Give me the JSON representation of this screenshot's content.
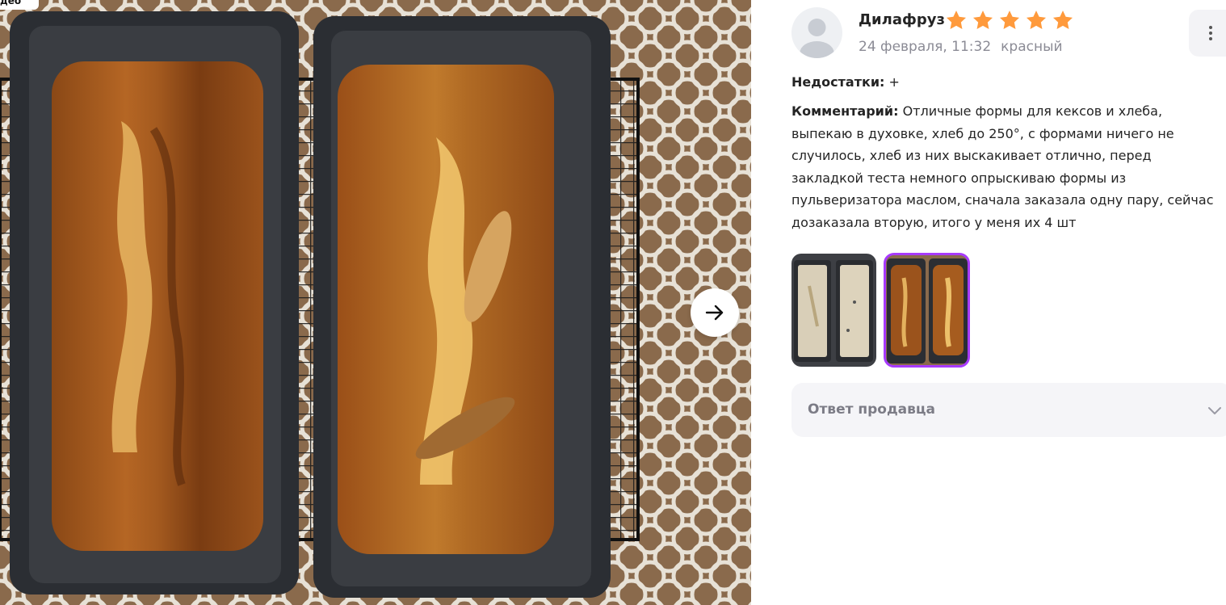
{
  "viewer": {
    "corner_tab_label": "део",
    "photo_alt": "Two banana bread loaves in dark rectangular baking pans on a wire rack over a lace tablecloth"
  },
  "review": {
    "author": "Дилафруз",
    "rating": 5,
    "rating_max": 5,
    "date": "24 февраля, 11:32",
    "color": "красный",
    "cons_label": "Недостатки:",
    "cons_value": "+",
    "comment_label": "Комментарий:",
    "comment_text": "Отличные формы для кексов и хлеба, выпекаю в духовке, хлеб до 250°, с формами ничего не случилось, хлеб из них выскакивает отлично, перед закладкой теста немного опрыскиваю формы из пульверизатора маслом, сначала заказала одну пару, сейчас дозаказала вторую, итого у меня их 4 шт",
    "seller_reply_label": "Ответ продавца"
  },
  "thumbnails": [
    {
      "name": "raw-dough-photo",
      "selected": false
    },
    {
      "name": "baked-bread-photo",
      "selected": true
    }
  ],
  "colors": {
    "star": "#ff9a3c",
    "selected_outline": "#a73afd",
    "meta_text": "#8b8b95",
    "panel_bg": "#f5f5f8"
  },
  "icons": {
    "next": "arrow-right-icon",
    "more": "kebab-menu-icon",
    "expand": "chevron-down-icon",
    "avatar": "user-silhouette-icon"
  }
}
